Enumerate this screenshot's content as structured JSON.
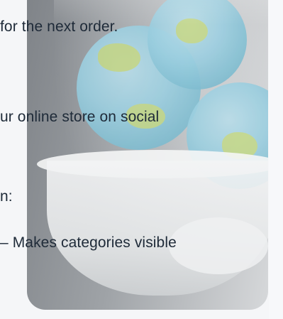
{
  "lines": {
    "line1": " for the next order.",
    "line2": "ur online store on social",
    "line3": "n:",
    "line4": "– Makes categories visible"
  },
  "image": {
    "icon": "globe-bowl-icon",
    "colors": {
      "tile_dark": "#7f8388",
      "tile_light": "#d6d8da",
      "globe_blue": "#9ccfe0",
      "land_green": "#c8d97e",
      "text": "#1e2a38"
    }
  }
}
